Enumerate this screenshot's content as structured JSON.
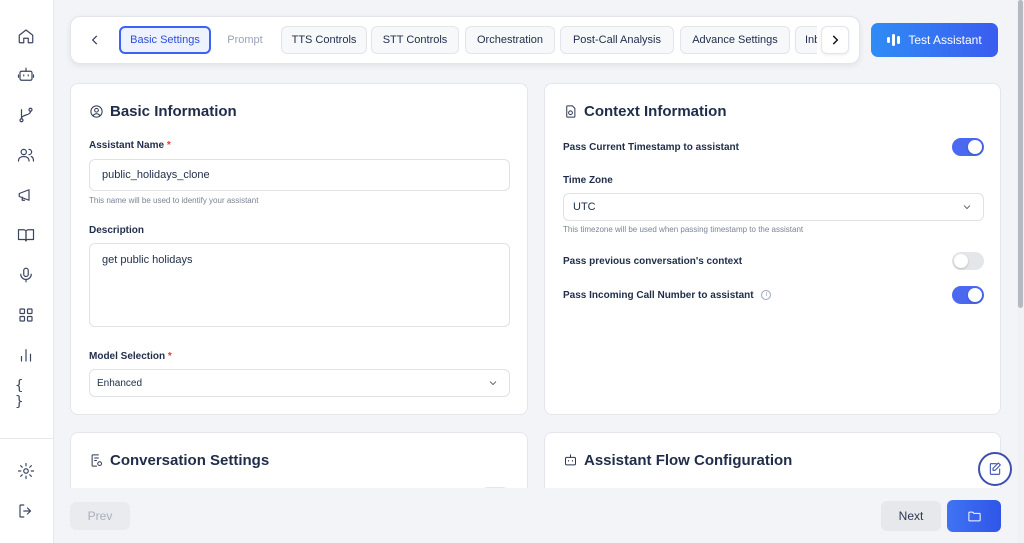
{
  "sidebar": {
    "icons": [
      "home-icon",
      "bot-icon",
      "git-branch-icon",
      "users-icon",
      "megaphone-icon",
      "book-icon",
      "microphone-icon",
      "grid-icon",
      "bar-chart-icon",
      "braces-icon",
      "settings-icon",
      "logout-icon"
    ],
    "braces_glyph": "{ }"
  },
  "tabs": [
    {
      "label": "Basic Settings",
      "state": "active"
    },
    {
      "label": "Prompt",
      "state": "muted"
    },
    {
      "label": "TTS Controls",
      "state": "normal"
    },
    {
      "label": "STT Controls",
      "state": "normal"
    },
    {
      "label": "Orchestration",
      "state": "normal"
    },
    {
      "label": "Post-Call Analysis",
      "state": "normal"
    },
    {
      "label": "Advance Settings",
      "state": "normal"
    },
    {
      "label": "Inbound",
      "state": "normal"
    }
  ],
  "header": {
    "test_button": "Test Assistant"
  },
  "basic_info": {
    "title": "Basic Information",
    "name_label": "Assistant Name",
    "required_mark": "*",
    "name_value": "public_holidays_clone",
    "name_hint": "This name will be used to identify your assistant",
    "description_label": "Description",
    "description_value": "get public holidays",
    "model_label": "Model Selection",
    "model_value": "Enhanced"
  },
  "context_info": {
    "title": "Context Information",
    "timestamp_label": "Pass Current Timestamp to assistant",
    "timestamp_on": true,
    "timezone_label": "Time Zone",
    "timezone_value": "UTC",
    "timezone_hint": "This timezone will be used when passing timestamp to the assistant",
    "prev_context_label": "Pass previous conversation's context",
    "prev_context_on": false,
    "incoming_number_label": "Pass Incoming Call Number to assistant",
    "incoming_number_on": true,
    "info_glyph": "i"
  },
  "conversation_settings": {
    "title": "Conversation Settings"
  },
  "flow_config": {
    "title": "Assistant Flow Configuration"
  },
  "footer": {
    "prev_label": "Prev",
    "next_label": "Next"
  },
  "colors": {
    "accent": "#3b5cf0",
    "toggle_on": "#4a68f0",
    "required": "#e03a3a"
  }
}
